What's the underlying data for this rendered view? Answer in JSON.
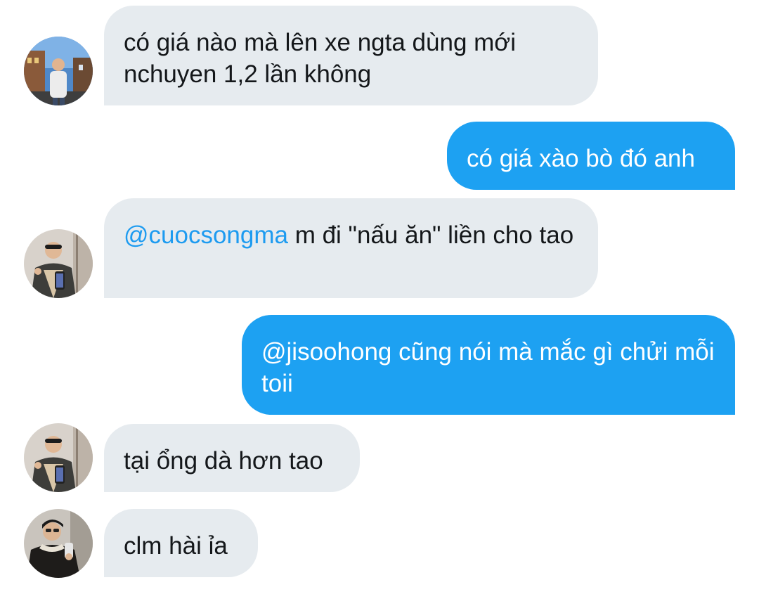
{
  "messages": [
    {
      "direction": "incoming",
      "avatar": "avatar-city-street",
      "mention": "",
      "text": "có giá nào mà lên xe ngta dùng mới nchuyen 1,2 lần không"
    },
    {
      "direction": "outgoing",
      "mention": "",
      "text": "có giá xào bò đó anh"
    },
    {
      "direction": "incoming",
      "avatar": "avatar-mirror-selfie",
      "mention": "@cuocsongma",
      "text": " m đi \"nấu ăn\" liền cho tao"
    },
    {
      "direction": "outgoing",
      "mention": "",
      "text": "@jisoohong cũng nói mà mắc gì chửi mỗi toii"
    },
    {
      "direction": "incoming",
      "avatar": "avatar-mirror-selfie",
      "mention": "",
      "text": "tại ổng dà hơn tao"
    },
    {
      "direction": "incoming",
      "avatar": "avatar-dark-jacket",
      "mention": "",
      "text": "clm hài ỉa"
    }
  ],
  "colors": {
    "incoming_bubble": "#e6ebef",
    "outgoing_bubble": "#1da1f2",
    "mention": "#1d9bf0"
  }
}
